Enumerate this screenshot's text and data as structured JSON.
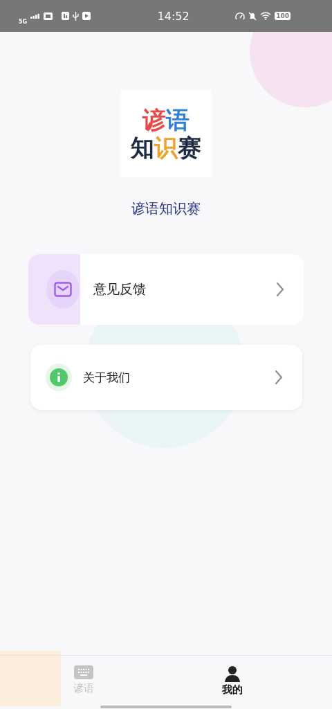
{
  "status_bar": {
    "network": "5G",
    "time": "14:52",
    "battery": "100"
  },
  "app": {
    "logo_lines": [
      "谚语",
      "知识赛"
    ],
    "name": "谚语知识赛"
  },
  "menu": [
    {
      "kind": "feedback",
      "label": "意见反馈",
      "pressed": true
    },
    {
      "kind": "about",
      "label": "关于我们",
      "pressed": false
    }
  ],
  "tabs": [
    {
      "kind": "proverbs",
      "label": "谚语",
      "selected": false
    },
    {
      "kind": "me",
      "label": "我的",
      "selected": true
    }
  ]
}
